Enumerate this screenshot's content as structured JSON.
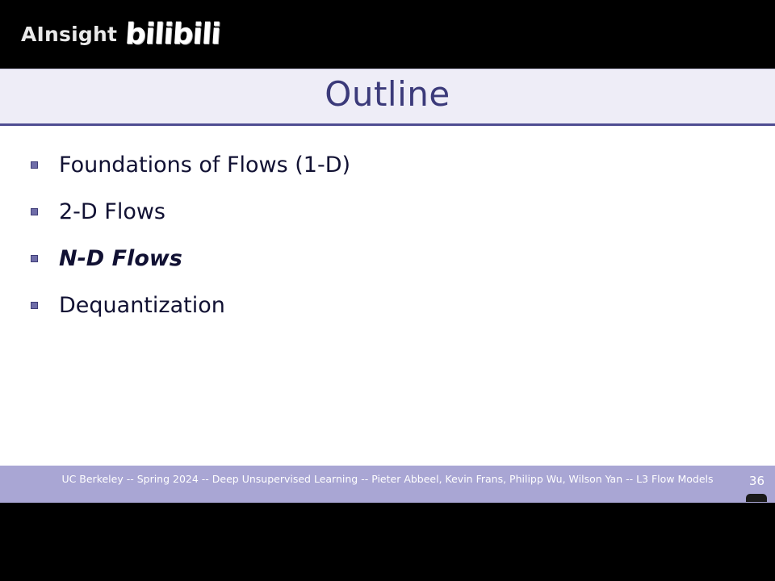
{
  "watermark": {
    "text": "AInsight",
    "logo": "bilibili"
  },
  "slide": {
    "title": "Outline",
    "bullets": [
      {
        "label": "Foundations of Flows (1-D)",
        "active": false
      },
      {
        "label": "2-D Flows",
        "active": false
      },
      {
        "label": "N-D Flows",
        "active": true
      },
      {
        "label": "Dequantization",
        "active": false
      }
    ],
    "footer": "UC Berkeley -- Spring 2024 -- Deep Unsupervised Learning -- Pieter Abbeel, Kevin Frans, Philipp Wu, Wilson Yan -- L3 Flow Models",
    "page_number": "36"
  },
  "colors": {
    "title": "#3b3a7a",
    "footer_bg": "#a9a6d4",
    "title_rule": "#4f4d92"
  }
}
